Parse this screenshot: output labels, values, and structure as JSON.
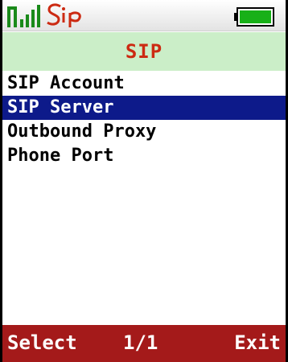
{
  "status_bar": {
    "signal_icon": "signal-strength-icon",
    "logo_text": "Sip",
    "battery_icon": "battery-icon",
    "colors": {
      "signal": "#1a8a1a",
      "logo": "#cc2a12",
      "battery_fill": "#18b018"
    }
  },
  "header": {
    "title": "SIP"
  },
  "menu": {
    "items": [
      {
        "label": "SIP Account",
        "selected": false
      },
      {
        "label": "SIP Server",
        "selected": true
      },
      {
        "label": "Outbound Proxy",
        "selected": false
      },
      {
        "label": "Phone Port",
        "selected": false
      }
    ]
  },
  "softkeys": {
    "left": "Select",
    "page": "1/1",
    "right": "Exit"
  },
  "colors": {
    "title_bar_bg": "#cbeec8",
    "title_text": "#cc2a12",
    "selection_bg": "#0d1a8a",
    "softkey_bg": "#a41a1a"
  }
}
